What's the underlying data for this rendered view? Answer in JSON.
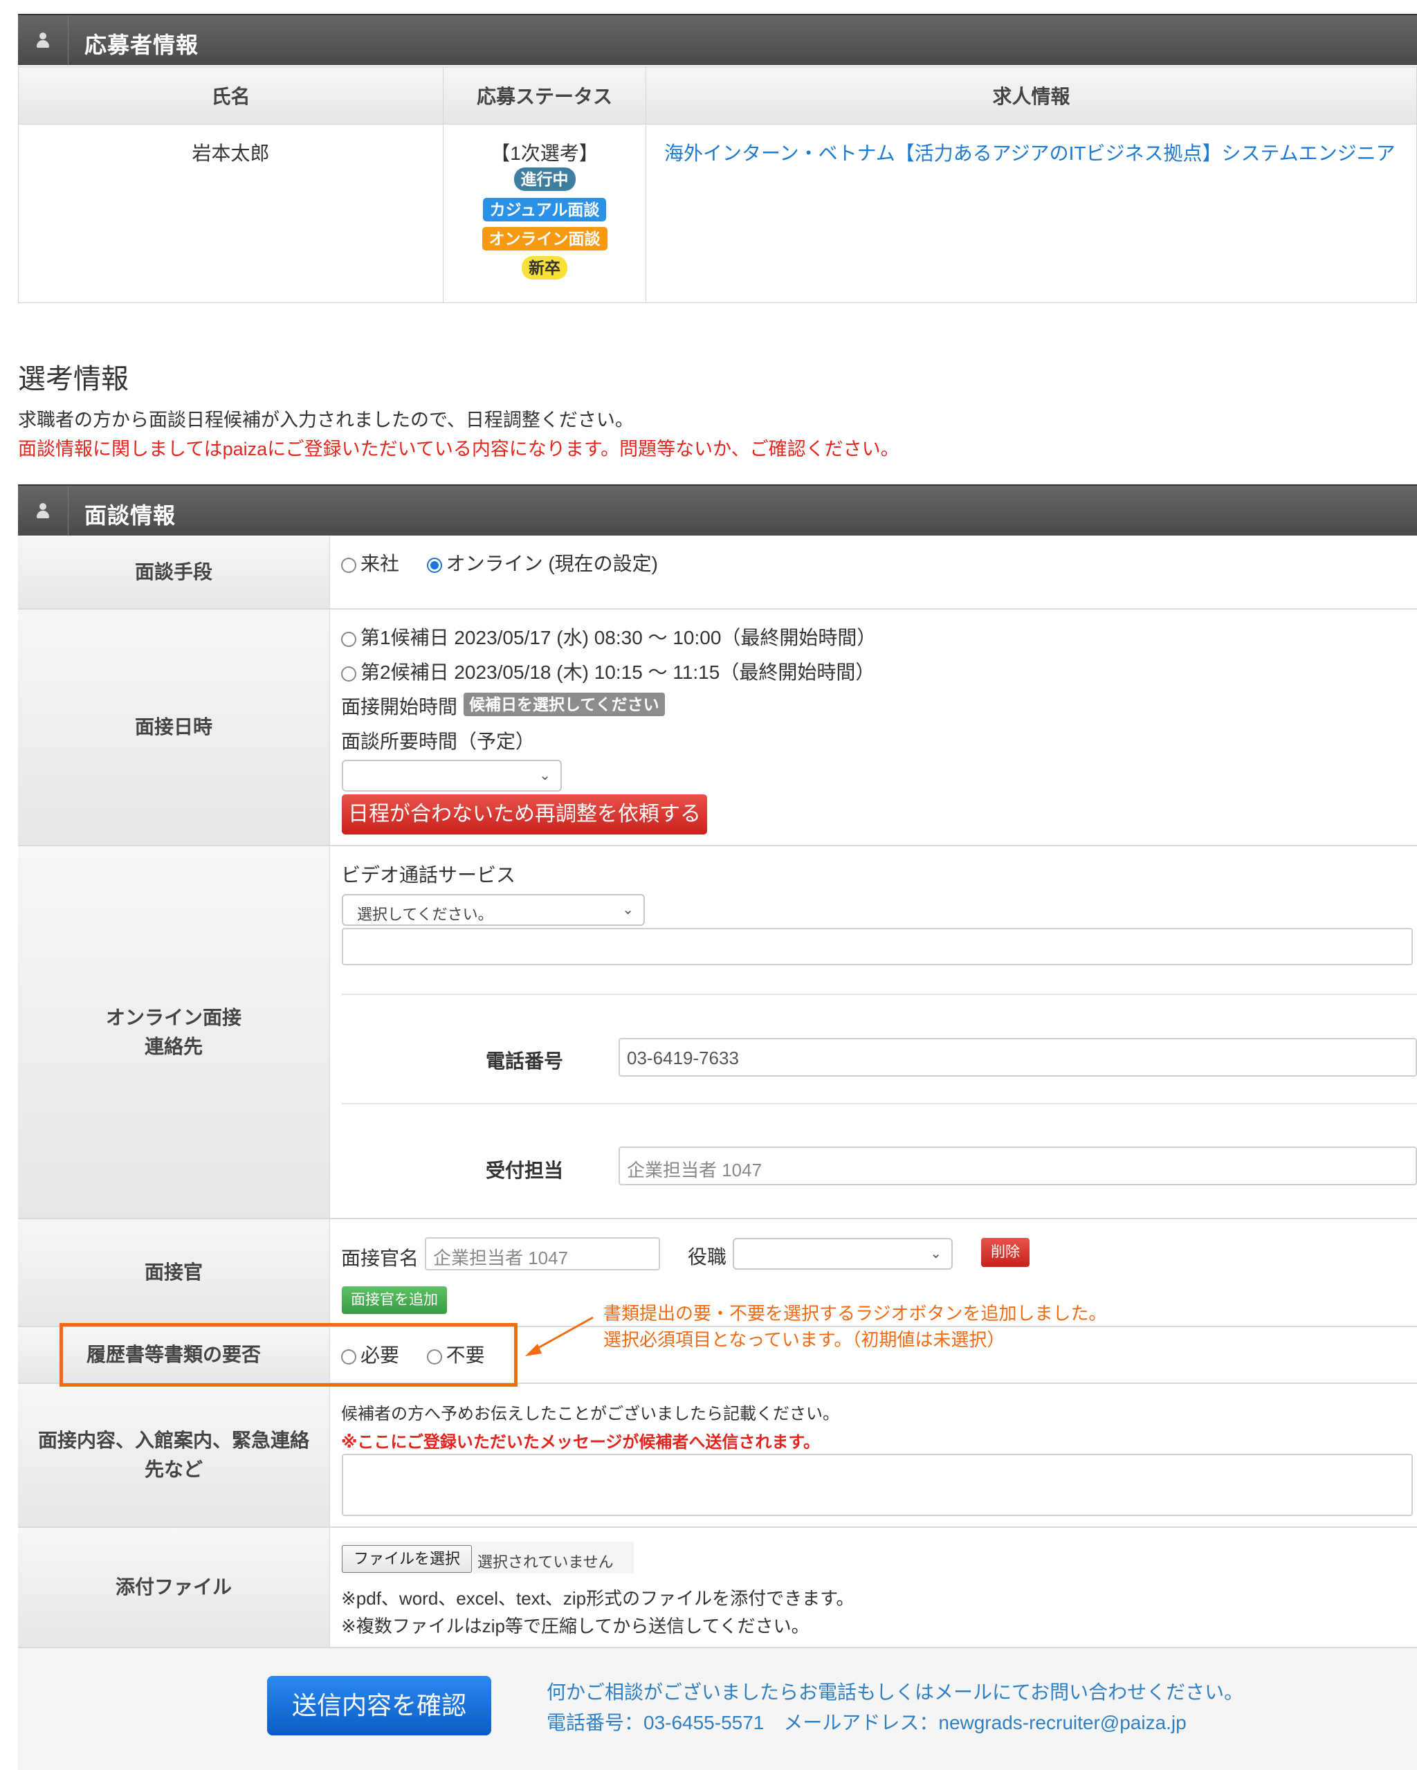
{
  "applicant_section": {
    "title": "応募者情報",
    "columns": [
      "氏名",
      "応募ステータス",
      "求人情報"
    ],
    "name": "岩本太郎",
    "stage": "【1次選考】",
    "badges": {
      "progress": "進行中",
      "casual": "カジュアル面談",
      "online": "オンライン面談",
      "new_grad": "新卒"
    },
    "job_link": "海外インターン・ベトナム【活力あるアジアのITビジネス拠点】システムエンジニア"
  },
  "selection": {
    "heading": "選考情報",
    "intro": "求職者の方から面談日程候補が入力されましたので、日程調整ください。",
    "notice": "面談情報に関しましてはpaizaにご登録いただいている内容になります。問題等ないか、ご確認ください。"
  },
  "interview_section": {
    "title": "面談情報",
    "method": {
      "label": "面談手段",
      "option_visit": "来社",
      "option_online": "オンライン (現在の設定)",
      "selected": "online"
    },
    "datetime": {
      "label": "面接日時",
      "candidate1": "第1候補日 2023/05/17 (水) 08:30 〜 10:00（最終開始時間）",
      "candidate2": "第2候補日 2023/05/18 (木) 10:15 〜 11:15（最終開始時間）",
      "start_label": "面接開始時間",
      "start_chip": "候補日を選択してください",
      "duration_label": "面談所要時間（予定）",
      "duration_value": "",
      "reschedule_button": "日程が合わないため再調整を依頼する"
    },
    "online_contact": {
      "label_line1": "オンライン面接",
      "label_line2": "連絡先",
      "video_label": "ビデオ通話サービス",
      "video_select": "選択してください。",
      "video_detail": "",
      "phone_label": "電話番号",
      "phone_value": "03-6419-7633",
      "reception_label": "受付担当",
      "reception_placeholder": "企業担当者 1047"
    },
    "interviewer": {
      "label": "面接官",
      "name_label": "面接官名",
      "name_placeholder": "企業担当者 1047",
      "role_label": "役職",
      "role_value": "",
      "delete_button": "削除",
      "add_button": "面接官を追加"
    },
    "documents": {
      "label": "履歴書等書類の要否",
      "option_required": "必要",
      "option_not_required": "不要"
    },
    "annotation": {
      "line1": "書類提出の要・不要を選択するラジオボタンを追加しました。",
      "line2": "選択必須項目となっています。（初期値は未選択）",
      "color": "#f26b14"
    },
    "message": {
      "label": "面接内容、入館案内、緊急連絡先など",
      "hint": "候補者の方へ予めお伝えしたことがございましたら記載ください。",
      "warning": "※ここにご登録いただいたメッセージが候補者へ送信されます。",
      "value": ""
    },
    "attachment": {
      "label": "添付ファイル",
      "choose_button": "ファイルを選択",
      "no_file": "選択されていません",
      "note1": "※pdf、word、excel、text、zip形式のファイルを添付できます。",
      "note2": "※複数ファイルはzip等で圧縮してから送信してください。"
    }
  },
  "footer": {
    "confirm_button": "送信内容を確認",
    "contact_line1": "何かご相談がございましたらお電話もしくはメールにてお問い合わせください。",
    "contact_line2": "電話番号：03-6455-5571　メールアドレス：newgrads-recruiter@paiza.jp"
  },
  "colors": {
    "accent_blue": "#1e7ad0",
    "danger_red": "#d0322a",
    "warning_red": "#e0261e",
    "annotation_orange": "#f26b14"
  }
}
